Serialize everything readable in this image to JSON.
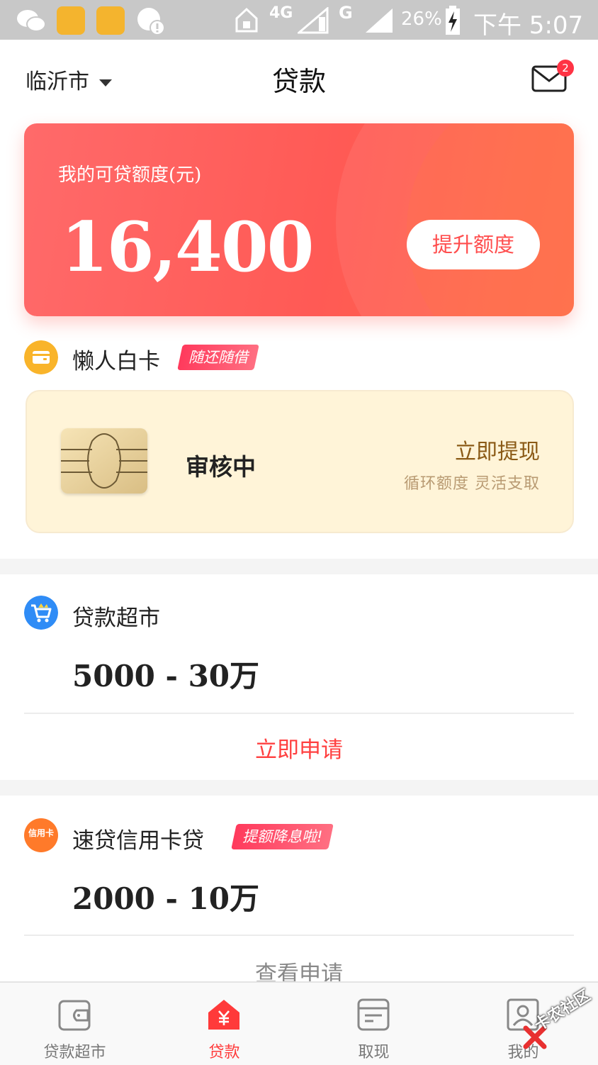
{
  "status_bar": {
    "battery": "26%",
    "network": "4G",
    "network2": "G",
    "time": "下午 5:07"
  },
  "header": {
    "city": "临沂市",
    "title": "贷款",
    "mail_badge": "2"
  },
  "credit": {
    "label": "我的可贷额度(元)",
    "amount": "16,400",
    "button": "提升额度"
  },
  "lazy_card": {
    "title": "懒人白卡",
    "tag": "随还随借",
    "status": "审核中",
    "action": "立即提现",
    "action_sub": "循环额度 灵活支取"
  },
  "loan_market": {
    "title": "贷款超市",
    "range": "5000 - 30万",
    "apply": "立即申请"
  },
  "credit_card_loan": {
    "title": "速贷信用卡贷",
    "icon_text": "信用卡",
    "tag": "提额降息啦!",
    "range": "2000 - 10万",
    "apply": "查看申请"
  },
  "tabs": [
    {
      "label": "贷款超市",
      "icon": "wallet-icon",
      "active": false
    },
    {
      "label": "贷款",
      "icon": "yen-house-icon",
      "active": true
    },
    {
      "label": "取现",
      "icon": "bill-icon",
      "active": false
    },
    {
      "label": "我的",
      "icon": "profile-icon",
      "active": false
    }
  ],
  "watermark": "卡农社区",
  "colors": {
    "accent": "#ff4d4d",
    "tab_active": "#ff3a3a",
    "card_bg": "#fff4d8"
  }
}
